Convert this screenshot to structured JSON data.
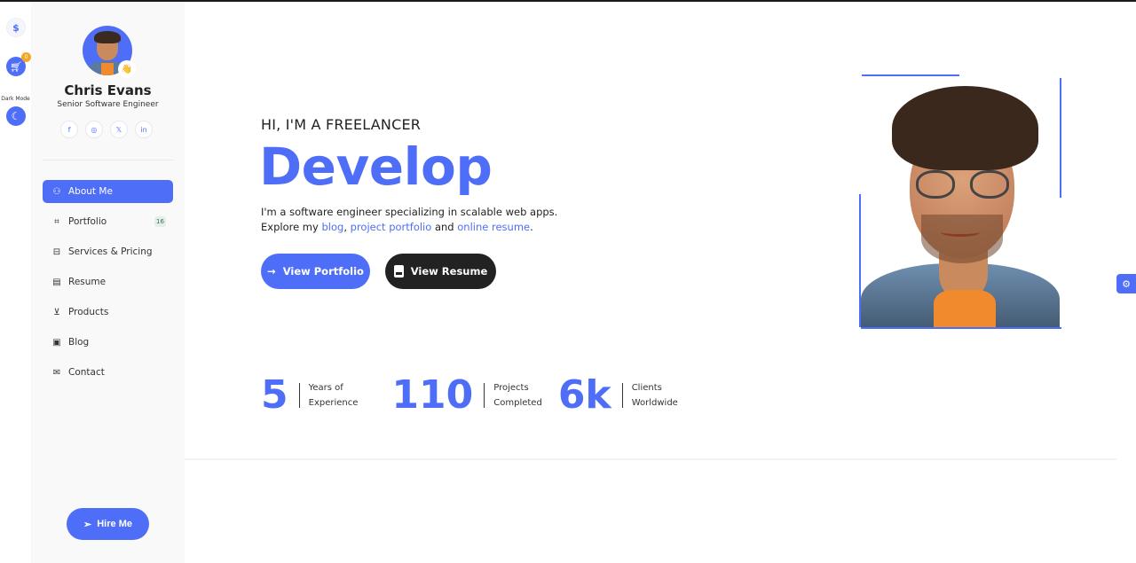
{
  "rail": {
    "logo_icon": "$",
    "cart_badge": "0",
    "dark_mode_label": "Dark Mode"
  },
  "sidebar": {
    "name": "Chris Evans",
    "role": "Senior Software Engineer",
    "socials": [
      {
        "name": "facebook",
        "glyph": "f"
      },
      {
        "name": "instagram",
        "glyph": "◎"
      },
      {
        "name": "x",
        "glyph": "𝕏"
      },
      {
        "name": "linkedin",
        "glyph": "in"
      }
    ],
    "nav": [
      {
        "label": "About Me",
        "icon": "user-icon",
        "glyph": "⚇",
        "active": true
      },
      {
        "label": "Portfolio",
        "icon": "code-icon",
        "glyph": "⌗",
        "badge": "16"
      },
      {
        "label": "Services & Pricing",
        "icon": "briefcase-icon",
        "glyph": "⊟"
      },
      {
        "label": "Resume",
        "icon": "resume-icon",
        "glyph": "▤"
      },
      {
        "label": "Products",
        "icon": "products-icon",
        "glyph": "⊻"
      },
      {
        "label": "Blog",
        "icon": "blog-icon",
        "glyph": "▣"
      },
      {
        "label": "Contact",
        "icon": "mail-icon",
        "glyph": "✉"
      }
    ],
    "hire_label": "Hire Me"
  },
  "hero": {
    "eyebrow": "HI, I'M A FREELANCER",
    "headline": "Develop",
    "intro_line1": "I'm a software engineer specializing in scalable web apps.",
    "intro_prefix": "Explore my ",
    "link_blog": "blog",
    "sep1": ", ",
    "link_portfolio": "project portfolio",
    "sep2": " and ",
    "link_resume": "online resume",
    "suffix": ".",
    "btn_portfolio": "View Portfolio",
    "btn_resume": "View Resume"
  },
  "stats": [
    {
      "value": "5",
      "line1": "Years of",
      "line2": "Experience"
    },
    {
      "value": "110",
      "line1": "Projects",
      "line2": "Completed"
    },
    {
      "value": "6k",
      "line1": "Clients",
      "line2": "Worldwide"
    }
  ],
  "colors": {
    "accent": "#4f6ef7",
    "dark_button": "#222222",
    "sidebar_bg": "#f9f9fa"
  }
}
